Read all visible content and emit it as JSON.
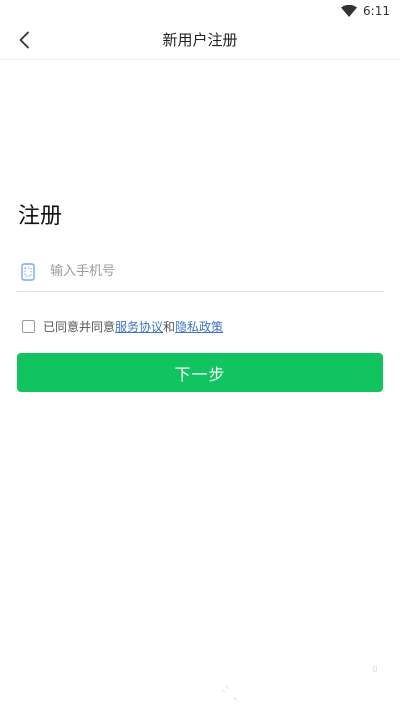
{
  "status_bar": {
    "time": "6:11",
    "wifi_icon": "wifi-icon"
  },
  "header": {
    "title": "新用户注册",
    "back_icon": "back-chevron-icon"
  },
  "page": {
    "title": "注册"
  },
  "phone_field": {
    "icon": "phone-icon",
    "value": "",
    "placeholder": "输入手机号"
  },
  "agreement": {
    "checked": false,
    "prefix": "已同意并同意",
    "service_link": "服务协议",
    "conjunction": "和",
    "privacy_link": "隐私政策"
  },
  "next_button": {
    "label": "下一步"
  },
  "colors": {
    "accent": "#12c45f",
    "link": "#3d74c4"
  }
}
